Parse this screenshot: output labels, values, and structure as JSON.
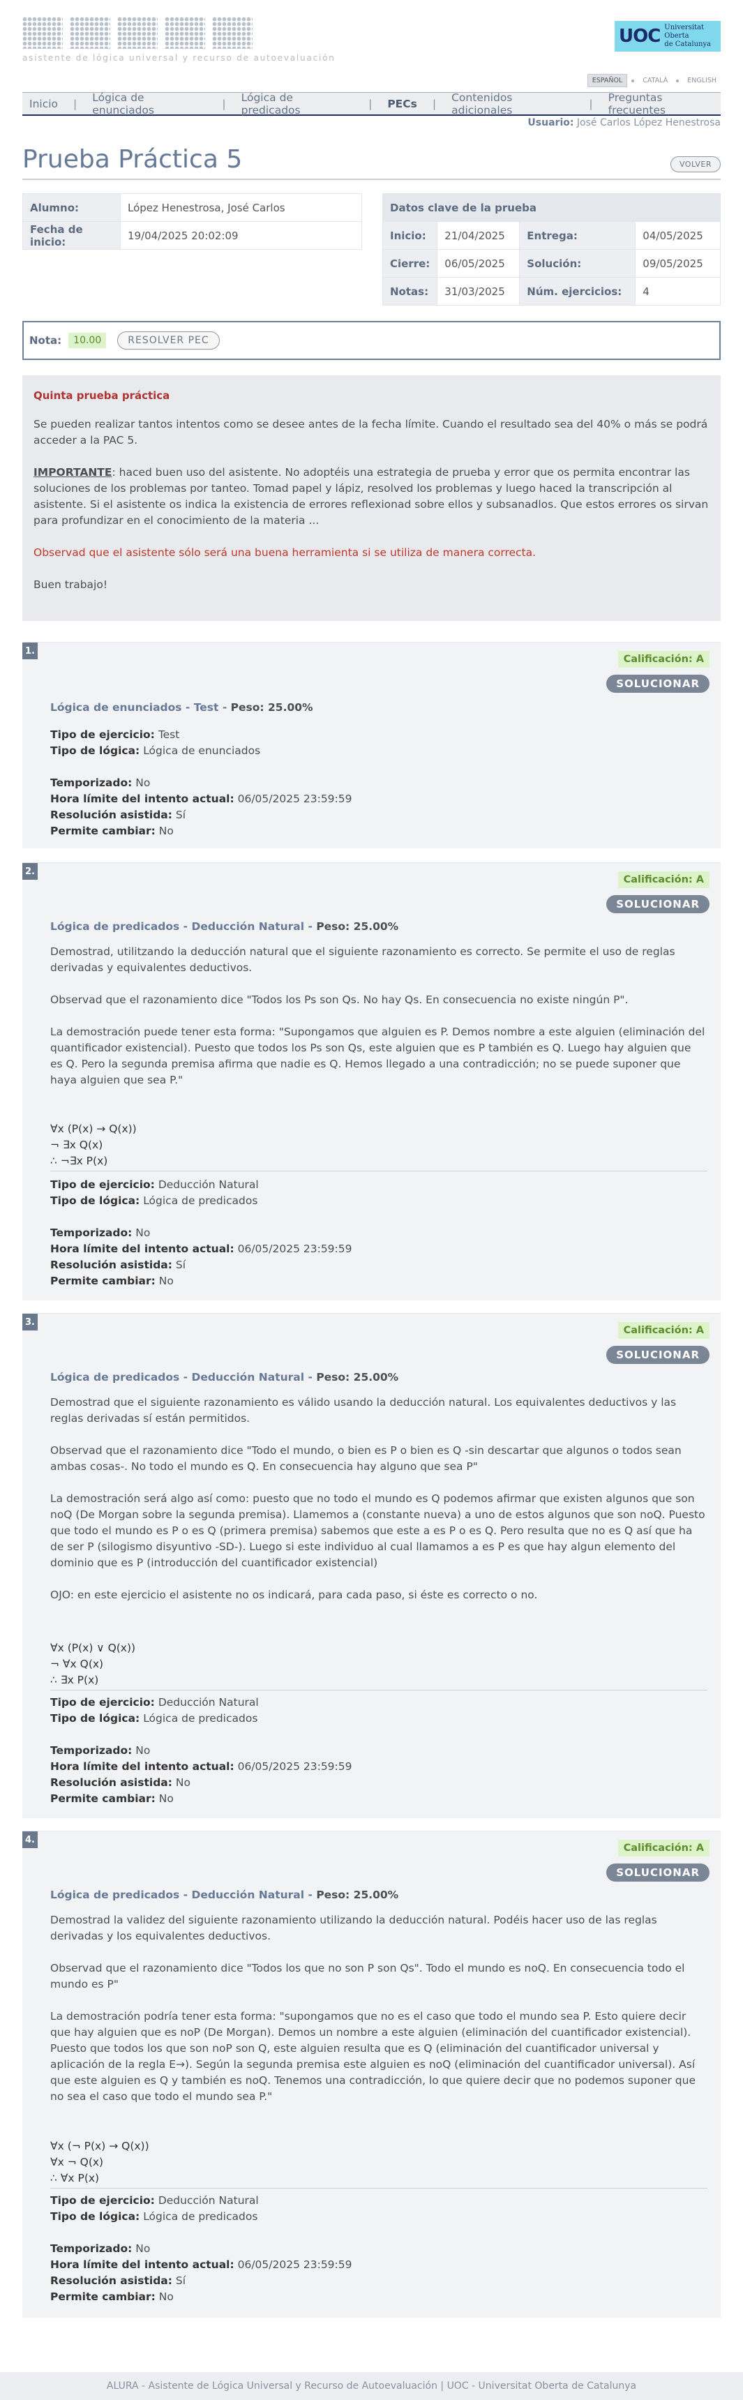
{
  "header": {
    "logo_text": "ALURA",
    "logo_subtitle": "asistente de lógica universal y recurso de autoevaluación",
    "uoc_mark": "UOC",
    "uoc_line1": "Universitat Oberta",
    "uoc_line2": "de Catalunya"
  },
  "languages": [
    "ESPAÑOL",
    "CATALÀ",
    "ENGLISH"
  ],
  "nav": [
    "Inicio",
    "Lógica de enunciados",
    "Lógica de predicados",
    "PECs",
    "Contenidos adicionales",
    "Preguntas frecuentes"
  ],
  "user": {
    "label": "Usuario:",
    "name": "José Carlos López Henestrosa"
  },
  "page": {
    "title": "Prueba Práctica 5",
    "back_label": "VOLVER"
  },
  "student": {
    "alumno_label": "Alumno:",
    "alumno": "López Henestrosa, José Carlos",
    "fecha_label": "Fecha de inicio:",
    "fecha": "19/04/2025 20:02:09"
  },
  "key_data": {
    "title": "Datos clave de la prueba",
    "inicio_label": "Inicio:",
    "inicio": "21/04/2025",
    "entrega_label": "Entrega:",
    "entrega": "04/05/2025",
    "cierre_label": "Cierre:",
    "cierre": "06/05/2025",
    "solucion_label": "Solución:",
    "solucion": "09/05/2025",
    "notas_label": "Notas:",
    "notas": "31/03/2025",
    "num_label": "Núm. ejercicios:",
    "num": "4"
  },
  "nota": {
    "label": "Nota:",
    "value": "10.00",
    "resolver": "RESOLVER PEC"
  },
  "intro": {
    "heading": "Quinta prueba práctica",
    "p1": "Se pueden realizar tantos intentos como se desee antes de la fecha límite. Cuando el resultado sea del 40% o más se podrá acceder a la PAC 5.",
    "p2_strong": "IMPORTANTE",
    "p2": ": haced buen uso del asistente. No adoptéis una estrategia de prueba y error que os permita encontrar las soluciones de los problemas por tanteo. Tomad papel y lápiz, resolved los problemas y luego haced la transcripción al asistente. Si el asistente os indica la existencia de errores reflexionad sobre ellos y subsanadlos. Que estos errores os sirvan para profundizar en el conocimiento de la materia ...",
    "p3": "Observad que el asistente sólo será una buena herramienta si se utiliza de manera correcta.",
    "p4": "Buen trabajo!"
  },
  "labels": {
    "calificacion": "Calificación: A",
    "solucionar": "SOLUCIONAR",
    "peso": "Peso: 25.00%",
    "tipo_ejercicio": "Tipo de ejercicio:",
    "tipo_logica": "Tipo de lógica:",
    "temporizado": "Temporizado:",
    "hora_limite": "Hora límite del intento actual:",
    "resolucion": "Resolución asistida:",
    "permite": "Permite cambiar:"
  },
  "exercises": [
    {
      "num": "1.",
      "title": "Lógica de enunciados - Test",
      "tipo_ejercicio": "Test",
      "tipo_logica": "Lógica de enunciados",
      "temporizado": "No",
      "hora_limite": "06/05/2025 23:59:59",
      "resolucion": "Sí",
      "permite": "No"
    },
    {
      "num": "2.",
      "title": "Lógica de predicados - Deducción Natural",
      "p1": "Demostrad, utilitzando la deducción natural que el siguiente razonamiento es correcto. Se permite el uso de reglas derivadas y equivalentes deductivos.",
      "p2": "Observad que el razonamiento dice \"Todos los Ps son Qs. No hay Qs. En consecuencia no existe ningún P\".",
      "p3": "La demostración puede tener esta forma: \"Supongamos que alguien es P. Demos nombre a este alguien (eliminación del quantificador existencial). Puesto que todos los Ps son Qs, este alguien que es P también es Q. Luego hay alguien que es Q. Pero la segunda premisa afirma que nadie es Q. Hemos llegado a una contradicción; no se puede suponer que haya alguien que sea P.\"",
      "f1": "∀x (P(x) → Q(x))",
      "f2": "¬ ∃x Q(x)",
      "f3": "∴ ¬∃x P(x)",
      "tipo_ejercicio": "Deducción Natural",
      "tipo_logica": "Lógica de predicados",
      "temporizado": "No",
      "hora_limite": "06/05/2025 23:59:59",
      "resolucion": "Sí",
      "permite": "No"
    },
    {
      "num": "3.",
      "title": "Lógica de predicados - Deducción Natural",
      "p1": "Demostrad que el siguiente razonamiento es válido usando la deducción natural. Los equivalentes deductivos y las reglas derivadas sí están permitidos.",
      "p2": "Observad que el razonamiento dice \"Todo el mundo, o bien es P o bien es Q -sin descartar que algunos o todos sean ambas cosas-. No todo el mundo es Q. En consecuencia hay alguno que sea P\"",
      "p3": "La demostración será algo así como: puesto que no todo el mundo es Q podemos afirmar que existen algunos que son noQ (De Morgan sobre la segunda premisa). Llamemos a (constante nueva) a uno de estos algunos que son noQ. Puesto que todo el mundo es P o es Q (primera premisa) sabemos que este a es P o es Q. Pero resulta que no es Q así que ha de ser P (silogismo disyuntivo -SD-). Luego si este individuo al cual llamamos a es P es que hay algun elemento del dominio que es P (introducción del cuantificador existencial)",
      "p4": "OJO: en este ejercicio el asistente no os indicará, para cada paso, si éste es correcto o no.",
      "f1": "∀x (P(x) ∨ Q(x))",
      "f2": "¬ ∀x Q(x)",
      "f3": "∴ ∃x P(x)",
      "tipo_ejercicio": "Deducción Natural",
      "tipo_logica": "Lógica de predicados",
      "temporizado": "No",
      "hora_limite": "06/05/2025 23:59:59",
      "resolucion": "No",
      "permite": "No"
    },
    {
      "num": "4.",
      "title": "Lógica de predicados - Deducción Natural",
      "p1": "Demostrad la validez del siguiente razonamiento utilizando la deducción natural. Podéis hacer uso de las reglas derivadas y los equivalentes deductivos.",
      "p2": "Observad que el razonamiento dice \"Todos los que no son P son Qs\". Todo el mundo es noQ. En consecuencia todo el mundo es P\"",
      "p3": "La demostración podría tener esta forma: \"supongamos que no es el caso que todo el mundo sea P. Esto quiere decir que hay alguien que es noP (De Morgan). Demos un nombre a este alguien (eliminación del cuantificador existencial). Puesto que todos los que son noP son Q, este alguien resulta que es Q (eliminación del cuantificador universal y aplicación de la regla E→). Según la segunda premisa este alguien es noQ (eliminación del cuantificador universal). Así que este alguien es Q y también es noQ. Tenemos una contradicción, lo que quiere decir que no podemos suponer que no sea el caso que todo el mundo sea P.\"",
      "f1": "∀x (¬ P(x) → Q(x))",
      "f2": "∀x ¬ Q(x)",
      "f3": "∴ ∀x P(x)",
      "tipo_ejercicio": "Deducción Natural",
      "tipo_logica": "Lógica de predicados",
      "temporizado": "No",
      "hora_limite": "06/05/2025 23:59:59",
      "resolucion": "Sí",
      "permite": "No"
    }
  ],
  "footer": {
    "left": "ALURA - Asistente de Lógica Universal y Recurso de Autoevaluación",
    "right": "UOC - Universitat Oberta de Catalunya"
  },
  "colors": {
    "accent": "#667996",
    "nav_border": "#1f2f5f",
    "grade_bg": "#ddf3c9",
    "grade_text": "#5d8d2e",
    "intro_heading": "#b03333"
  }
}
